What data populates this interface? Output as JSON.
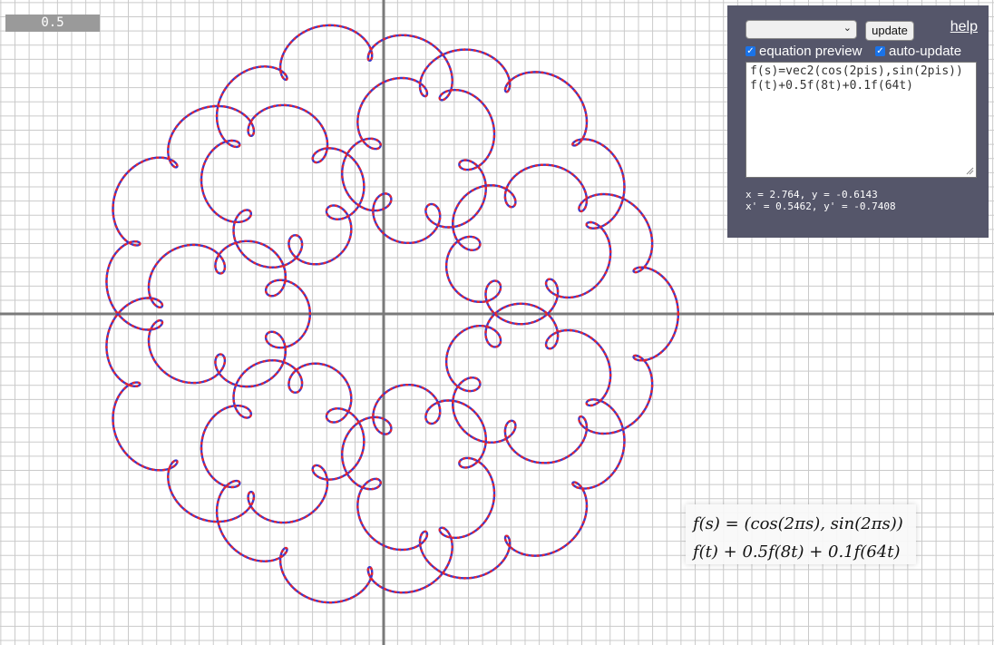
{
  "slider": {
    "value": "0.5"
  },
  "panel": {
    "preset": "",
    "update_label": "update",
    "help_label": "help",
    "equation_preview_label": "equation preview",
    "auto_update_label": "auto-update",
    "equation_preview_checked": true,
    "auto_update_checked": true,
    "equation_text": "f(s)=vec2(cos(2pis),sin(2pis))\nf(t)+0.5f(8t)+0.1f(64t)",
    "readout_line1": "x = 2.764, y = -0.6143",
    "readout_line2": "x' = 0.5462, y' = -0.7408"
  },
  "formula": {
    "line1": "f(s) = (cos(2πs), sin(2πs))",
    "line2": "f(t) + 0.5f(8t) + 0.1f(64t)"
  },
  "curve": {
    "a1": 1,
    "k1": 1,
    "a2": 0.5,
    "k2": 8,
    "a3": 0.1,
    "k3": 64
  },
  "colors": {
    "curve_a": "#e8242c",
    "curve_b": "#3a3acd",
    "panel_bg": "#55566a",
    "axis": "#7a7a7a",
    "grid": "#c9c9c9"
  }
}
